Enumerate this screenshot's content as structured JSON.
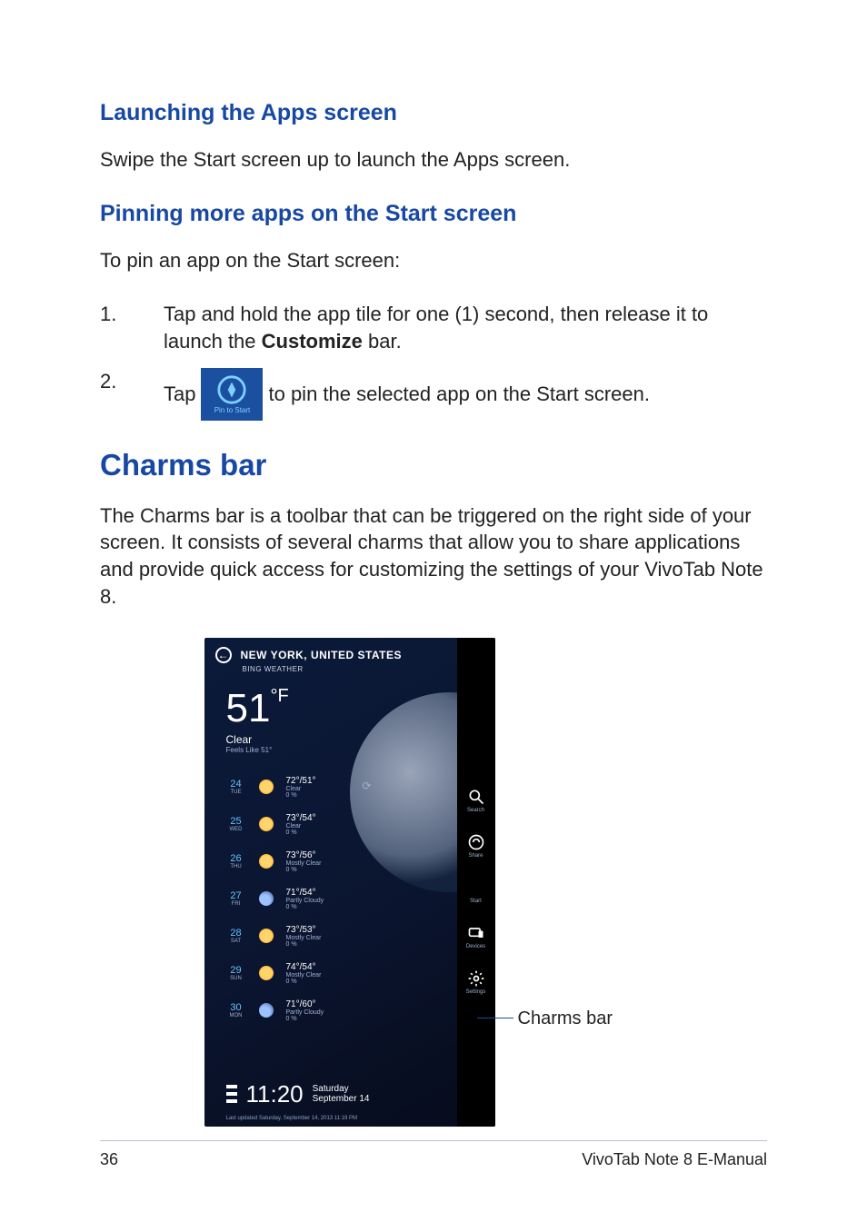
{
  "headings": {
    "launching": "Launching the Apps screen",
    "pinning": "Pinning more apps on the Start screen",
    "charms": "Charms bar"
  },
  "paragraphs": {
    "swipe": "Swipe the Start screen up to launch the Apps screen.",
    "to_pin": "To pin an app on the Start screen:",
    "charms_desc": "The Charms bar is a toolbar that can be triggered on the right side of your screen. It consists of several charms that allow you to share applications and provide quick access for customizing the settings of your VivoTab Note 8."
  },
  "steps": {
    "one": {
      "num": "1.",
      "text_a": "Tap and hold the app tile for one (1) second, then release it to launch the ",
      "bold": "Customize",
      "text_b": " bar."
    },
    "two": {
      "num": "2.",
      "text_a": "Tap ",
      "icon_label": "Pin to Start",
      "text_b": " to pin the selected app on the Start screen."
    }
  },
  "screenshot": {
    "city": "NEW YORK, UNITED STATES",
    "app": "BING WEATHER",
    "temp": "51",
    "unit": "°F",
    "cond": "Clear",
    "feels": "Feels Like 51°",
    "forecast": [
      {
        "d": "24",
        "wd": "TUE",
        "hl": "72°/51°",
        "c": "Clear",
        "p": "0 %",
        "icon": "sun"
      },
      {
        "d": "25",
        "wd": "WED",
        "hl": "73°/54°",
        "c": "Clear",
        "p": "0 %",
        "icon": "sun"
      },
      {
        "d": "26",
        "wd": "THU",
        "hl": "73°/56°",
        "c": "Mostly Clear",
        "p": "0 %",
        "icon": "sun"
      },
      {
        "d": "27",
        "wd": "FRI",
        "hl": "71°/54°",
        "c": "Partly Cloudy",
        "p": "0 %",
        "icon": "cloud"
      },
      {
        "d": "28",
        "wd": "SAT",
        "hl": "73°/53°",
        "c": "Mostly Clear",
        "p": "0 %",
        "icon": "sun"
      },
      {
        "d": "29",
        "wd": "SUN",
        "hl": "74°/54°",
        "c": "Mostly Clear",
        "p": "0 %",
        "icon": "sun"
      },
      {
        "d": "30",
        "wd": "MON",
        "hl": "71°/60°",
        "c": "Partly Cloudy",
        "p": "0 %",
        "icon": "cloud"
      }
    ],
    "refresh": "⟳",
    "time": "11:20",
    "dow": "Saturday",
    "date": "September 14",
    "updated": "Last updated Saturday, September 14, 2013 11:19 PM",
    "charms": {
      "search": "Search",
      "share": "Share",
      "start": "Start",
      "devices": "Devices",
      "settings": "Settings"
    }
  },
  "callout": "Charms bar",
  "footer": {
    "page": "36",
    "title": "VivoTab Note 8 E-Manual"
  }
}
